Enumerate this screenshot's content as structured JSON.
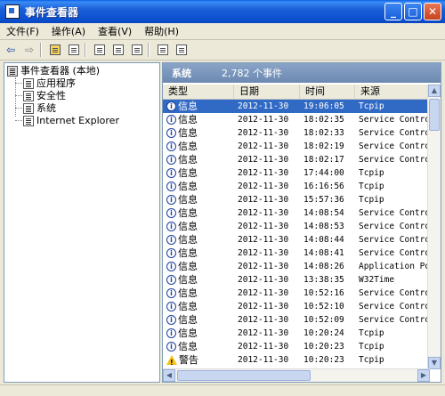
{
  "window": {
    "title": "事件查看器"
  },
  "menu": [
    "文件(F)",
    "操作(A)",
    "查看(V)",
    "帮助(H)"
  ],
  "tree": {
    "root": "事件查看器 (本地)",
    "children": [
      "应用程序",
      "安全性",
      "系统",
      "Internet Explorer"
    ]
  },
  "log": {
    "title": "系统",
    "count": "2,782 个事件"
  },
  "columns": [
    "类型",
    "日期",
    "时间",
    "来源"
  ],
  "rows": [
    {
      "type": "信息",
      "date": "2012-11-30",
      "time": "19:06:05",
      "source": "Tcpip",
      "icon": "info-icon"
    },
    {
      "type": "信息",
      "date": "2012-11-30",
      "time": "18:02:35",
      "source": "Service Control",
      "icon": "info-icon"
    },
    {
      "type": "信息",
      "date": "2012-11-30",
      "time": "18:02:33",
      "source": "Service Control",
      "icon": "info-icon"
    },
    {
      "type": "信息",
      "date": "2012-11-30",
      "time": "18:02:19",
      "source": "Service Control",
      "icon": "info-icon"
    },
    {
      "type": "信息",
      "date": "2012-11-30",
      "time": "18:02:17",
      "source": "Service Control",
      "icon": "info-icon"
    },
    {
      "type": "信息",
      "date": "2012-11-30",
      "time": "17:44:00",
      "source": "Tcpip",
      "icon": "info-icon"
    },
    {
      "type": "信息",
      "date": "2012-11-30",
      "time": "16:16:56",
      "source": "Tcpip",
      "icon": "info-icon"
    },
    {
      "type": "信息",
      "date": "2012-11-30",
      "time": "15:57:36",
      "source": "Tcpip",
      "icon": "info-icon"
    },
    {
      "type": "信息",
      "date": "2012-11-30",
      "time": "14:08:54",
      "source": "Service Control",
      "icon": "info-icon"
    },
    {
      "type": "信息",
      "date": "2012-11-30",
      "time": "14:08:53",
      "source": "Service Control",
      "icon": "info-icon"
    },
    {
      "type": "信息",
      "date": "2012-11-30",
      "time": "14:08:44",
      "source": "Service Control",
      "icon": "info-icon"
    },
    {
      "type": "信息",
      "date": "2012-11-30",
      "time": "14:08:41",
      "source": "Service Control",
      "icon": "info-icon"
    },
    {
      "type": "信息",
      "date": "2012-11-30",
      "time": "14:08:26",
      "source": "Application Pop",
      "icon": "info-icon"
    },
    {
      "type": "信息",
      "date": "2012-11-30",
      "time": "13:38:35",
      "source": "W32Time",
      "icon": "info-icon"
    },
    {
      "type": "信息",
      "date": "2012-11-30",
      "time": "10:52:16",
      "source": "Service Control",
      "icon": "info-icon"
    },
    {
      "type": "信息",
      "date": "2012-11-30",
      "time": "10:52:10",
      "source": "Service Control",
      "icon": "info-icon"
    },
    {
      "type": "信息",
      "date": "2012-11-30",
      "time": "10:52:09",
      "source": "Service Control",
      "icon": "info-icon"
    },
    {
      "type": "信息",
      "date": "2012-11-30",
      "time": "10:20:24",
      "source": "Tcpip",
      "icon": "info-icon"
    },
    {
      "type": "信息",
      "date": "2012-11-30",
      "time": "10:20:23",
      "source": "Tcpip",
      "icon": "info-icon"
    },
    {
      "type": "警告",
      "date": "2012-11-30",
      "time": "10:20:23",
      "source": "Tcpip",
      "icon": "warning-icon"
    }
  ]
}
